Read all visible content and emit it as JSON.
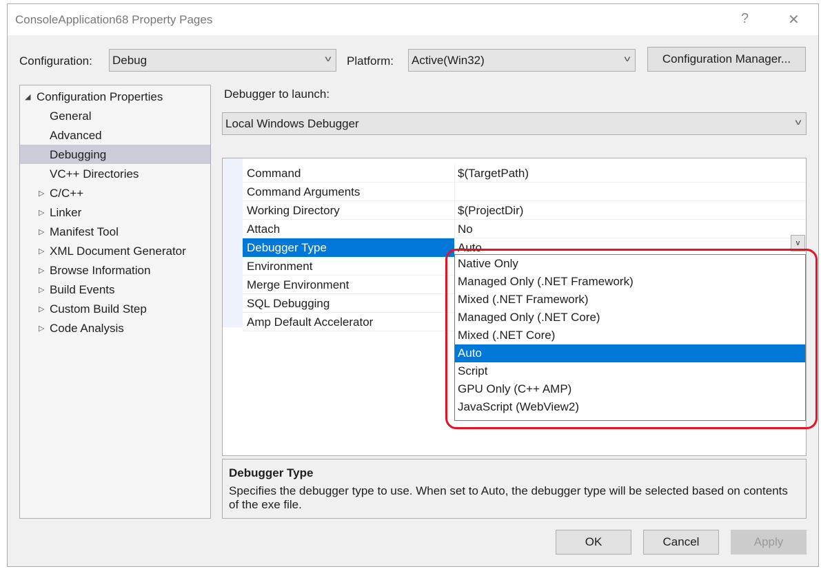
{
  "window": {
    "title": "ConsoleApplication68 Property Pages",
    "help": "?",
    "close": "✕"
  },
  "toolbar": {
    "configuration_label": "Configuration:",
    "configuration_value": "Debug",
    "platform_label": "Platform:",
    "platform_value": "Active(Win32)",
    "config_manager": "Configuration Manager..."
  },
  "tree": {
    "root": "Configuration Properties",
    "items": [
      {
        "label": "General",
        "expandable": false
      },
      {
        "label": "Advanced",
        "expandable": false
      },
      {
        "label": "Debugging",
        "expandable": false,
        "selected": true
      },
      {
        "label": "VC++ Directories",
        "expandable": false
      },
      {
        "label": "C/C++",
        "expandable": true
      },
      {
        "label": "Linker",
        "expandable": true
      },
      {
        "label": "Manifest Tool",
        "expandable": true
      },
      {
        "label": "XML Document Generator",
        "expandable": true
      },
      {
        "label": "Browse Information",
        "expandable": true
      },
      {
        "label": "Build Events",
        "expandable": true
      },
      {
        "label": "Custom Build Step",
        "expandable": true
      },
      {
        "label": "Code Analysis",
        "expandable": true
      }
    ]
  },
  "debugger": {
    "label": "Debugger to launch:",
    "value": "Local Windows Debugger"
  },
  "properties": [
    {
      "name": "Command",
      "value": "$(TargetPath)"
    },
    {
      "name": "Command Arguments",
      "value": ""
    },
    {
      "name": "Working Directory",
      "value": "$(ProjectDir)"
    },
    {
      "name": "Attach",
      "value": "No"
    },
    {
      "name": "Debugger Type",
      "value": "Auto",
      "selected": true
    },
    {
      "name": "Environment",
      "value": ""
    },
    {
      "name": "Merge Environment",
      "value": ""
    },
    {
      "name": "SQL Debugging",
      "value": ""
    },
    {
      "name": "Amp Default Accelerator",
      "value": ""
    }
  ],
  "dropdown": {
    "options": [
      "Native Only",
      "Managed Only (.NET Framework)",
      "Mixed (.NET Framework)",
      "Managed Only (.NET Core)",
      "Mixed (.NET Core)",
      "Auto",
      "Script",
      "GPU Only (C++ AMP)",
      "JavaScript (WebView2)"
    ],
    "selected": "Auto",
    "highlight_color": "#e81123"
  },
  "description": {
    "title": "Debugger Type",
    "text": "Specifies the debugger type to use. When set to Auto, the debugger type will be selected based on contents of the exe file."
  },
  "buttons": {
    "ok": "OK",
    "cancel": "Cancel",
    "apply": "Apply"
  }
}
